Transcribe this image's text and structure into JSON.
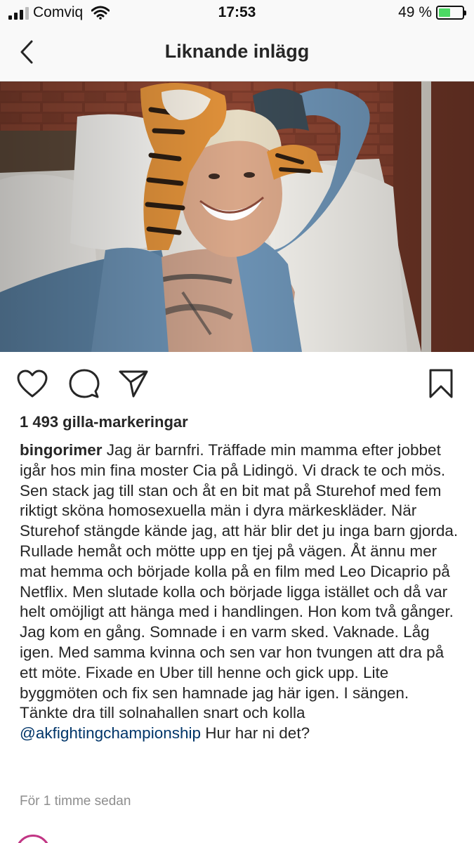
{
  "status_bar": {
    "carrier": "Comviq",
    "time": "17:53",
    "battery_percent": "49 %",
    "battery_level": 0.49
  },
  "nav": {
    "title": "Liknande inlägg"
  },
  "post": {
    "likes": "1 493 gilla-markeringar",
    "username": "bingorimer",
    "caption": " Jag är barnfri. Träffade min mamma efter jobbet igår hos min fina moster Cia på Lidingö. Vi drack te och mös. Sen stack jag till stan och åt en bit mat på Sturehof med fem riktigt sköna homosexuella män i dyra märkeskläder. När Sturehof stängde kände jag, att här blir det ju inga barn gjorda. Rullade hemåt och mötte upp en tjej på vägen. Åt ännu mer mat hemma och började kolla på en film med Leo Dicaprio på Netflix. Men slutade kolla och började ligga istället och då var helt omöjligt att hänga med i handlingen. Hon kom två gånger. Jag kom en gång. Somnade i en varm sked. Vaknade. Låg igen. Med samma kvinna och sen var hon tvungen att dra på ett möte. Fixade en Uber till henne och gick upp. Lite byggmöten och fix sen hamnade jag här igen. I sängen. Tänkte dra till solnahallen snart och kolla ",
    "mention": "@akfightingchampionship",
    "caption_end": " Hur har ni det?",
    "timestamp": "För 1 timme sedan"
  },
  "icons": {
    "back": "chevron-left-icon",
    "like": "heart-icon",
    "comment": "comment-bubble-icon",
    "share": "paper-plane-icon",
    "save": "bookmark-icon"
  },
  "colors": {
    "text": "#262626",
    "muted": "#8e8e8e",
    "mention": "#003569",
    "battery": "#4cd964"
  }
}
